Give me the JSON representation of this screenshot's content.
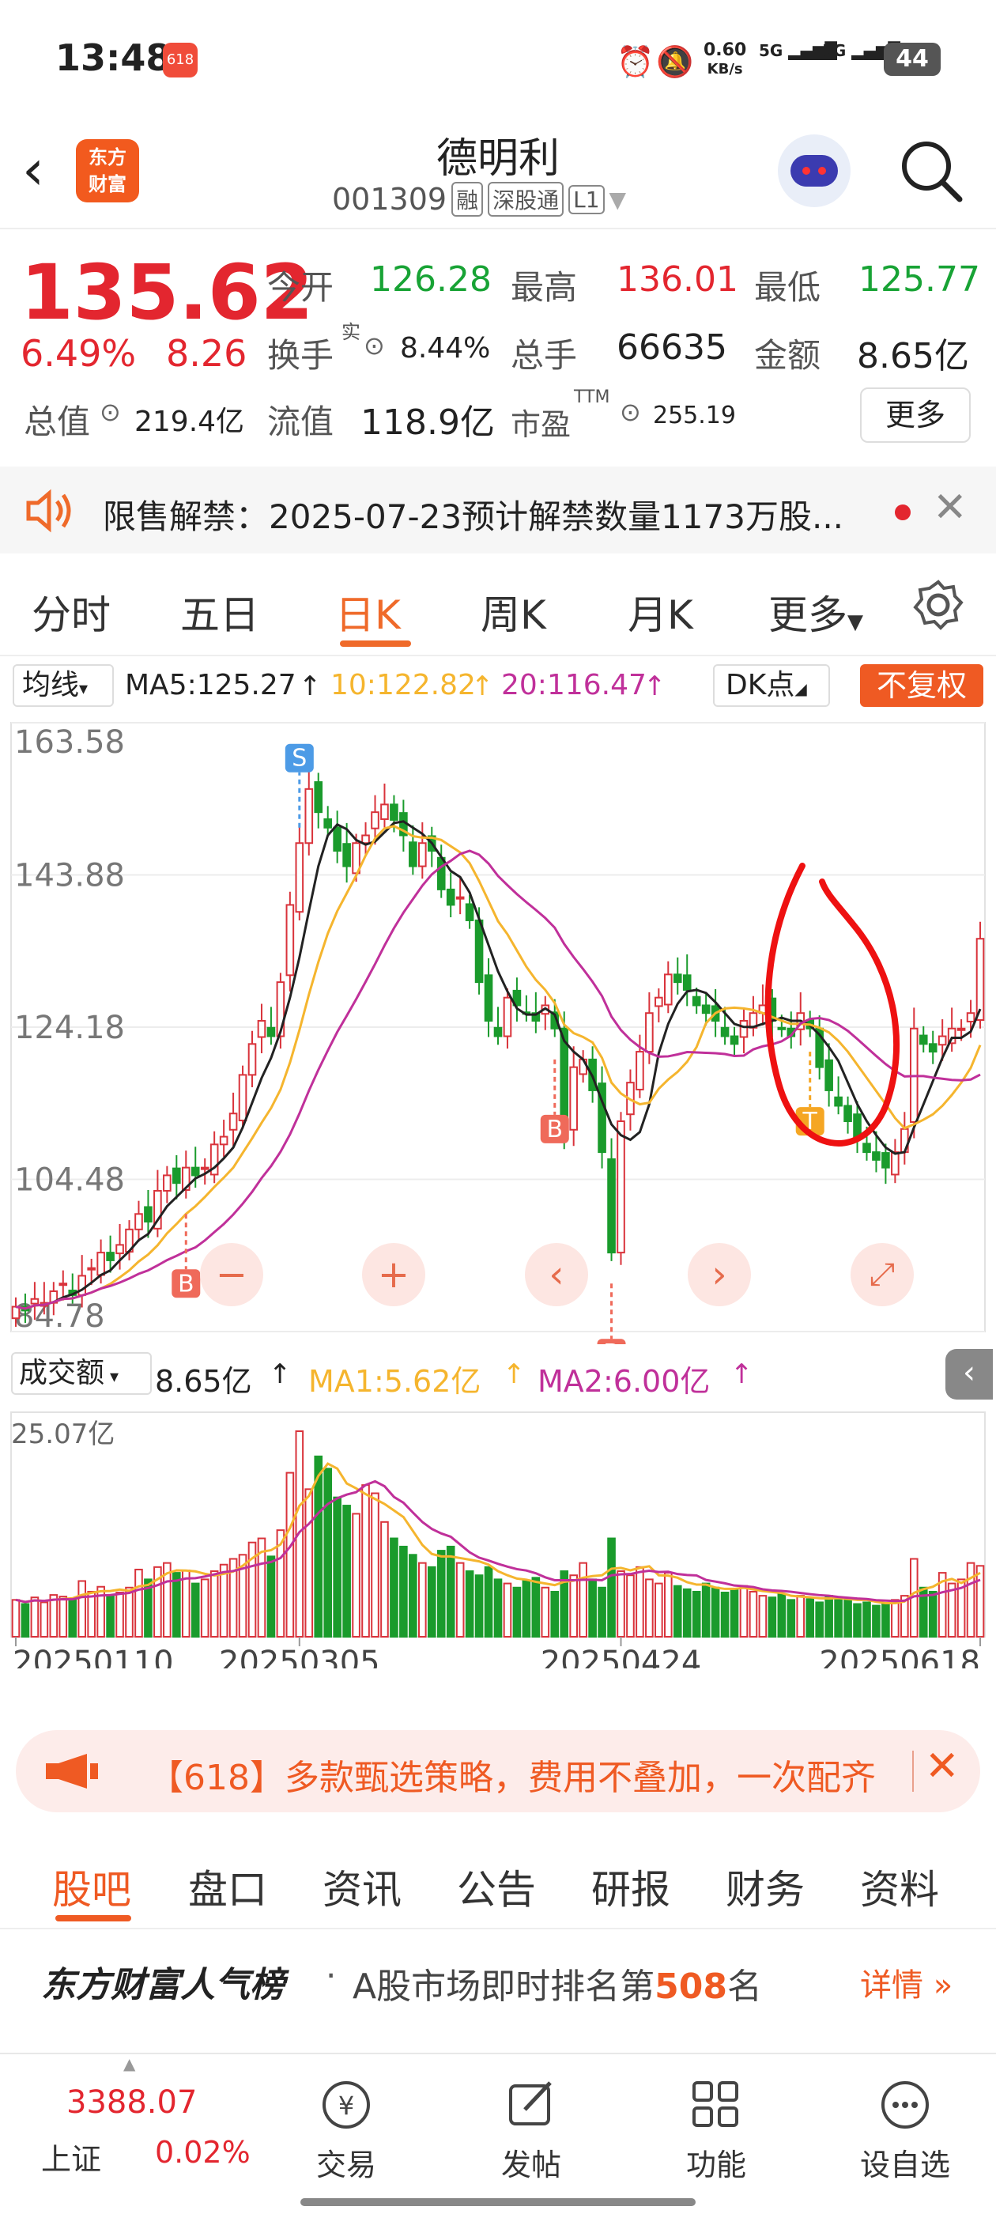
{
  "status_bar": {
    "time": "13:48",
    "net_speed": "0.60",
    "net_unit": "KB/s",
    "sig1": "5G",
    "sig2": "5G",
    "battery": "44",
    "app_badge": "618"
  },
  "header": {
    "back_icon": "back-arrow-icon",
    "logo_line1": "东方",
    "logo_line2": "财富",
    "stock_name": "德明利",
    "stock_code": "001309",
    "tags": [
      "融",
      "深股通",
      "L1"
    ]
  },
  "quote": {
    "price": "135.62",
    "change_pct": "6.49%",
    "change_amt": "8.26",
    "open_label": "今开",
    "open": "126.28",
    "high_label": "最高",
    "high": "136.01",
    "low_label": "最低",
    "low": "125.77",
    "turnover_label": "换手",
    "turnover_sup": "实",
    "turnover": "8.44%",
    "volume_label": "总手",
    "volume": "66635",
    "amount_label": "金额",
    "amount": "8.65亿",
    "mktcap_label": "总值",
    "mktcap": "219.4亿",
    "float_label": "流值",
    "float": "118.9亿",
    "pe_label": "市盈",
    "pe_sup": "TTM",
    "pe": "255.19",
    "more_button": "更多"
  },
  "notice": {
    "text": "限售解禁：2025-07-23预计解禁数量1173万股..."
  },
  "period_tabs": [
    {
      "label": "分时"
    },
    {
      "label": "五日"
    },
    {
      "label": "日K",
      "active": true
    },
    {
      "label": "周K"
    },
    {
      "label": "月K"
    },
    {
      "label": "更多"
    }
  ],
  "chart_toolbar": {
    "ma_selector": "均线",
    "ma5": "MA5:125.27",
    "ma10": "10:122.82",
    "ma20": "20:116.47",
    "dk_button": "DK点",
    "adjust_button": "不复权"
  },
  "volume_toolbar": {
    "selector": "成交额",
    "value": "8.65亿",
    "ma1": "MA1:5.62亿",
    "ma2": "MA2:6.00亿",
    "max_label": "25.07亿"
  },
  "markers": {
    "s": "S",
    "b": "B",
    "t": "T"
  },
  "chart_data": {
    "type": "candlestick",
    "ylim": [
      84.78,
      163.58
    ],
    "y_ticks": [
      "163.58",
      "143.88",
      "124.18",
      "104.48",
      "84.78"
    ],
    "x_ticks": [
      "20250110",
      "20250305",
      "20250424",
      "20250618"
    ],
    "ma_colors": {
      "ma5": "#222222",
      "ma10": "#f5b52e",
      "ma20": "#c0309a"
    },
    "up_color": "#d9333b",
    "down_color": "#1a9b2c",
    "closes": [
      88,
      87.5,
      89,
      88.5,
      90,
      91,
      89.5,
      92,
      93,
      95,
      94,
      96,
      98,
      100,
      99,
      103,
      105,
      104,
      106,
      105,
      106,
      109,
      110,
      113,
      118,
      122,
      125,
      123,
      130,
      140,
      148,
      155,
      152,
      150,
      147,
      145,
      148,
      149,
      152,
      153,
      151,
      149,
      145,
      148,
      147,
      142,
      140,
      141,
      138,
      130,
      125,
      123,
      128,
      127,
      126,
      125,
      127,
      124,
      110,
      119,
      120,
      116,
      108,
      95,
      112,
      117,
      121,
      126,
      128,
      131,
      130,
      129,
      127,
      126,
      125,
      123,
      122,
      125,
      126,
      127,
      125,
      124,
      123,
      126,
      124,
      119,
      116,
      114,
      112,
      110,
      108,
      107,
      106,
      108,
      111,
      124,
      122,
      121,
      123,
      124,
      124,
      126,
      135.62
    ],
    "volumes": [
      4.5,
      4.0,
      4.8,
      4.2,
      5.1,
      4.9,
      4.5,
      6.8,
      5.5,
      6.1,
      5.0,
      5.4,
      6.0,
      8.2,
      7.0,
      8.5,
      9.0,
      7.8,
      8.1,
      6.5,
      7.0,
      8.0,
      8.8,
      9.5,
      10.0,
      11.5,
      12.0,
      9.8,
      13.0,
      20.0,
      25.07,
      18.0,
      22.0,
      20.5,
      17.0,
      16.0,
      15.0,
      18.5,
      17.5,
      14.0,
      12.0,
      11.0,
      10.0,
      9.0,
      8.5,
      10.5,
      11.0,
      9.0,
      8.0,
      7.5,
      8.5,
      7.0,
      6.5,
      6.0,
      6.8,
      7.2,
      6.0,
      5.5,
      8.0,
      7.5,
      9.0,
      7.0,
      6.0,
      12.0,
      8.0,
      7.5,
      8.5,
      7.0,
      6.5,
      7.8,
      6.2,
      5.8,
      5.5,
      6.5,
      6.0,
      5.4,
      5.8,
      6.2,
      5.5,
      5.0,
      4.8,
      5.2,
      4.5,
      5.0,
      4.6,
      4.2,
      5.0,
      4.8,
      4.5,
      4.0,
      4.2,
      3.8,
      4.0,
      4.5,
      5.0,
      9.5,
      6.0,
      5.5,
      7.8,
      6.5,
      7.0,
      9.0,
      8.65
    ]
  },
  "promo": {
    "text": "【618】多款甄选策略，费用不叠加，一次配齐"
  },
  "sub_tabs": [
    {
      "label": "股吧",
      "active": true
    },
    {
      "label": "盘口"
    },
    {
      "label": "资讯"
    },
    {
      "label": "公告"
    },
    {
      "label": "研报"
    },
    {
      "label": "财务"
    },
    {
      "label": "资料"
    }
  ],
  "rank": {
    "title": "东方财富人气榜",
    "dot": "·",
    "prefix": "A股市场即时排名第",
    "number": "508",
    "suffix": "名",
    "detail": "详情"
  },
  "bottom_nav": {
    "index_value": "3388.07",
    "index_name": "上证",
    "index_change": "0.02%",
    "items": [
      "交易",
      "发帖",
      "功能",
      "设自选"
    ]
  }
}
